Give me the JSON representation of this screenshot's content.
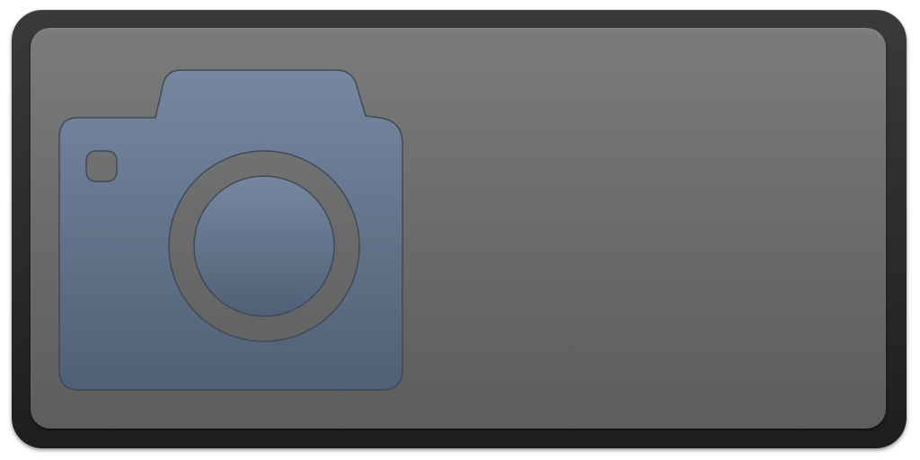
{
  "widget": {
    "icon": "camera-icon",
    "colors": {
      "frame": "#2e2e2e",
      "panel": "#6b6b6b",
      "icon_top": "#7688a0",
      "icon_bottom": "#4f6076"
    }
  }
}
